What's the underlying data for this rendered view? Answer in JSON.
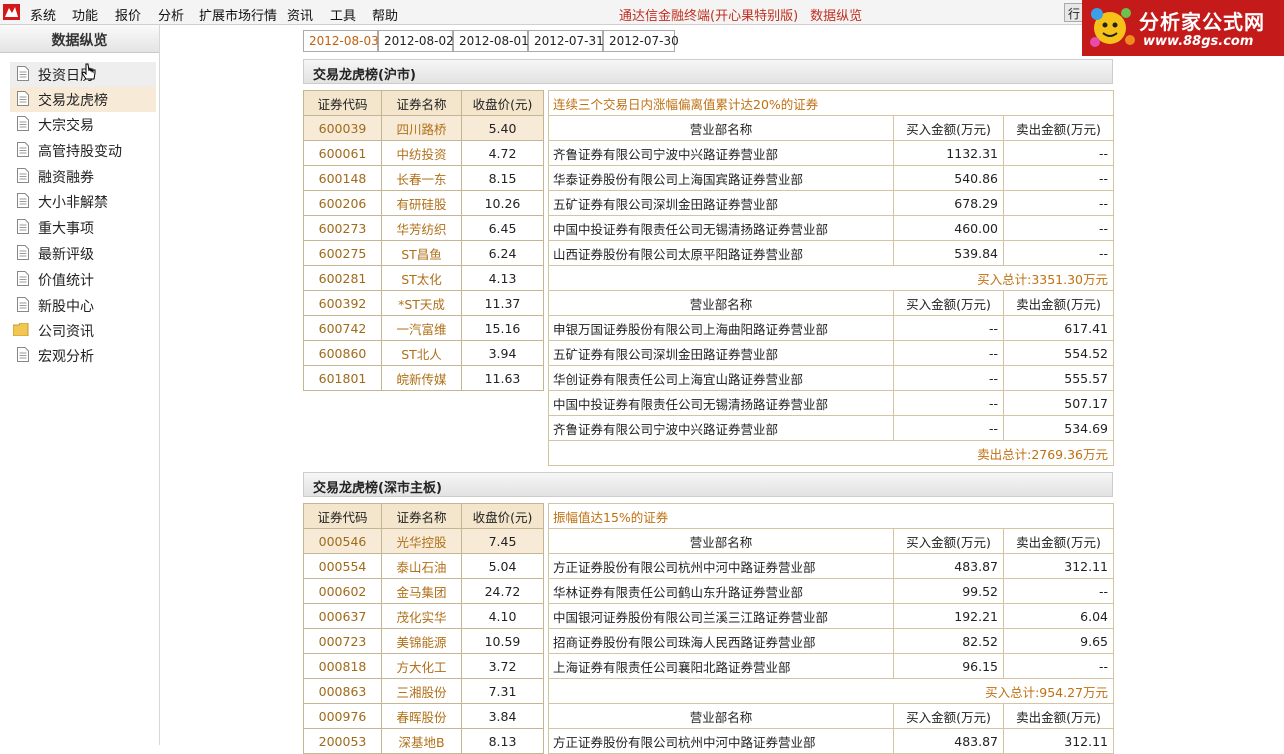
{
  "menu": {
    "items": [
      "系统",
      "功能",
      "报价",
      "分析",
      "扩展市场行情",
      "资讯",
      "工具",
      "帮助"
    ],
    "app_title": "通达信金融终端(开心果特别版)",
    "app_subtitle": "数据纵览",
    "quote_label": "行情"
  },
  "logo": {
    "title": "分析家公式网",
    "url": "www.88gs.com"
  },
  "sidebar": {
    "header": "数据纵览",
    "items": [
      "投资日历",
      "交易龙虎榜",
      "大宗交易",
      "高管持股变动",
      "融资融券",
      "大小非解禁",
      "重大事项",
      "最新评级",
      "价值统计",
      "新股中心",
      "公司资讯",
      "宏观分析"
    ],
    "selected_index": 1
  },
  "dates": [
    "2012-08-03",
    "2012-08-02",
    "2012-08-01",
    "2012-07-31",
    "2012-07-30"
  ],
  "sections": [
    {
      "title": "交易龙虎榜(沪市)",
      "stock_headers": [
        "证券代码",
        "证券名称",
        "收盘价(元)"
      ],
      "stocks": [
        [
          "600039",
          "四川路桥",
          "5.40"
        ],
        [
          "600061",
          "中纺投资",
          "4.72"
        ],
        [
          "600148",
          "长春一东",
          "8.15"
        ],
        [
          "600206",
          "有研硅股",
          "10.26"
        ],
        [
          "600273",
          "华芳纺织",
          "6.45"
        ],
        [
          "600275",
          "ST昌鱼",
          "6.24"
        ],
        [
          "600281",
          "ST太化",
          "4.13"
        ],
        [
          "600392",
          "*ST天成",
          "11.37"
        ],
        [
          "600742",
          "一汽富维",
          "15.16"
        ],
        [
          "600860",
          "ST北人",
          "3.94"
        ],
        [
          "601801",
          "皖新传媒",
          "11.63"
        ]
      ],
      "detail_caption": "连续三个交易日内涨幅偏离值累计达20%的证券",
      "broker_headers": [
        "营业部名称",
        "买入金额(万元)",
        "卖出金额(万元)"
      ],
      "buy_rows": [
        [
          "齐鲁证券有限公司宁波中兴路证券营业部",
          "1132.31",
          "--"
        ],
        [
          "华泰证券股份有限公司上海国宾路证券营业部",
          "540.86",
          "--"
        ],
        [
          "五矿证券有限公司深圳金田路证券营业部",
          "678.29",
          "--"
        ],
        [
          "中国中投证券有限责任公司无锡清扬路证券营业部",
          "460.00",
          "--"
        ],
        [
          "山西证券股份有限公司太原平阳路证券营业部",
          "539.84",
          "--"
        ]
      ],
      "buy_total": "买入总计:3351.30万元",
      "sell_rows": [
        [
          "申银万国证券股份有限公司上海曲阳路证券营业部",
          "--",
          "617.41"
        ],
        [
          "五矿证券有限公司深圳金田路证券营业部",
          "--",
          "554.52"
        ],
        [
          "华创证券有限责任公司上海宜山路证券营业部",
          "--",
          "555.57"
        ],
        [
          "中国中投证券有限责任公司无锡清扬路证券营业部",
          "--",
          "507.17"
        ],
        [
          "齐鲁证券有限公司宁波中兴路证券营业部",
          "--",
          "534.69"
        ]
      ],
      "sell_total": "卖出总计:2769.36万元"
    },
    {
      "title": "交易龙虎榜(深市主板)",
      "stock_headers": [
        "证券代码",
        "证券名称",
        "收盘价(元)"
      ],
      "stocks": [
        [
          "000546",
          "光华控股",
          "7.45"
        ],
        [
          "000554",
          "泰山石油",
          "5.04"
        ],
        [
          "000602",
          "金马集团",
          "24.72"
        ],
        [
          "000637",
          "茂化实华",
          "4.10"
        ],
        [
          "000723",
          "美锦能源",
          "10.59"
        ],
        [
          "000818",
          "方大化工",
          "3.72"
        ],
        [
          "000863",
          "三湘股份",
          "7.31"
        ],
        [
          "000976",
          "春晖股份",
          "3.84"
        ],
        [
          "200053",
          "深基地B",
          "8.13"
        ]
      ],
      "detail_caption": "振幅值达15%的证券",
      "broker_headers": [
        "营业部名称",
        "买入金额(万元)",
        "卖出金额(万元)"
      ],
      "buy_rows": [
        [
          "方正证券股份有限公司杭州中河中路证券营业部",
          "483.87",
          "312.11"
        ],
        [
          "华林证券有限责任公司鹤山东升路证券营业部",
          "99.52",
          "--"
        ],
        [
          "中国银河证券股份有限公司兰溪三江路证券营业部",
          "192.21",
          "6.04"
        ],
        [
          "招商证券股份有限公司珠海人民西路证券营业部",
          "82.52",
          "9.65"
        ],
        [
          "上海证券有限责任公司襄阳北路证券营业部",
          "96.15",
          "--"
        ]
      ],
      "buy_total": "买入总计:954.27万元",
      "sell_rows": [
        [
          "方正证券股份有限公司杭州中河中路证券营业部",
          "483.87",
          "312.11"
        ]
      ]
    }
  ]
}
